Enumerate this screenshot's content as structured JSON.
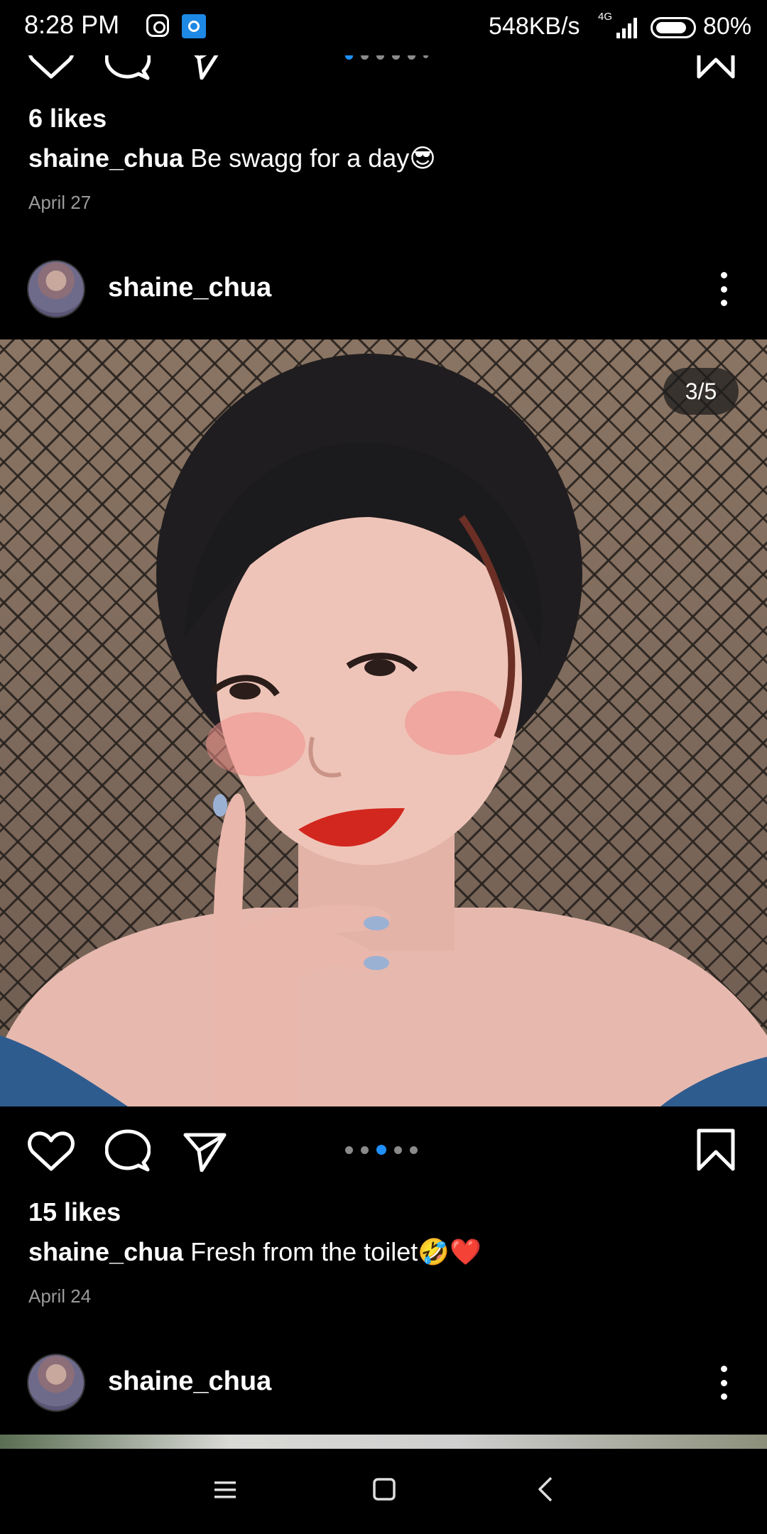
{
  "status_bar": {
    "time": "8:28 PM",
    "net_speed": "548KB/s",
    "network": "4G",
    "battery": "80%",
    "battery_level": 0.8,
    "icons": [
      "instagram-icon",
      "app-notification-icon",
      "signal-icon",
      "battery-icon"
    ]
  },
  "post_previous": {
    "likes": "6 likes",
    "username": "shaine_chua",
    "caption": "Be swagg for a day😎",
    "date": "April 27",
    "carousel": {
      "count": 6,
      "active_index": 1
    }
  },
  "post_current": {
    "username": "shaine_chua",
    "image_counter": "3/5",
    "image_alt": "selfie photo",
    "carousel": {
      "count": 5,
      "active_index": 3
    },
    "likes": "15 likes",
    "caption": "Fresh from the toilet🤣❤️",
    "date": "April 24"
  },
  "post_next": {
    "username": "shaine_chua"
  },
  "colors": {
    "background": "#000000",
    "text": "#ffffff",
    "muted": "#9a9a9a",
    "accent": "#1e90ff"
  },
  "nav_bar": {
    "icons": [
      "menu-icon",
      "home-icon",
      "back-icon"
    ]
  }
}
